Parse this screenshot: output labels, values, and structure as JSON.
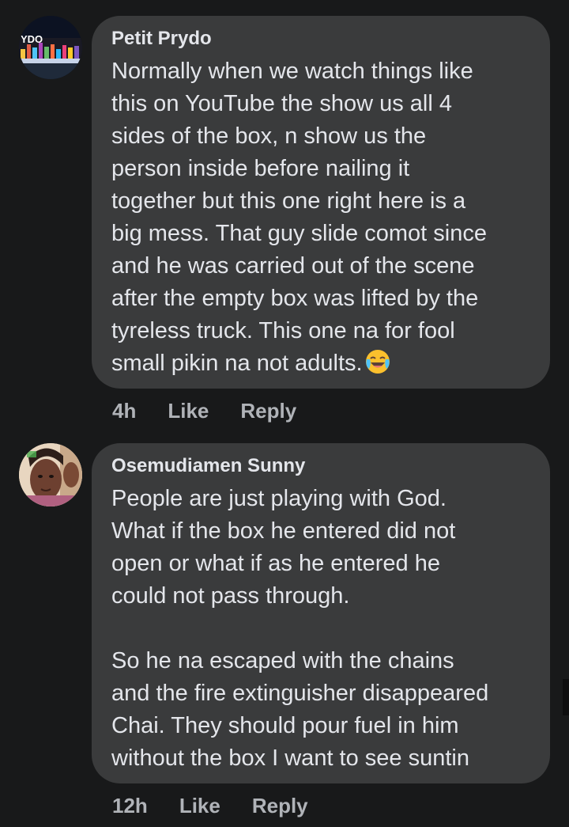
{
  "comments": [
    {
      "author": "Petit Prydo",
      "avatar_text": "YDO",
      "text": "Normally when we watch things like\nthis on YouTube the show us all 4\nsides of the box, n show us the\nperson inside before nailing it\ntogether but this one right here is a\nbig mess. That guy slide comot since\nand he was carried out of the scene\nafter the empty box was lifted by the\ntyreless truck. This one na for fool\nsmall pikin na not adults.",
      "emoji": "face-with-tears-of-joy-icon",
      "time": "4h",
      "like_label": "Like",
      "reply_label": "Reply"
    },
    {
      "author": "Osemudiamen Sunny",
      "text": "People are just playing with God.\nWhat if the box he entered did not\nopen or what if as he entered he\ncould not pass through.\n\nSo he na escaped with the chains\nand the fire extinguisher disappeared\nChai. They should pour fuel in him\nwithout the box I want to see suntin",
      "time": "12h",
      "like_label": "Like",
      "reply_label": "Reply"
    }
  ],
  "colors": {
    "background": "#18191a",
    "bubble": "#3a3b3c",
    "text": "#e4e6eb",
    "meta": "#b0b3b8"
  }
}
